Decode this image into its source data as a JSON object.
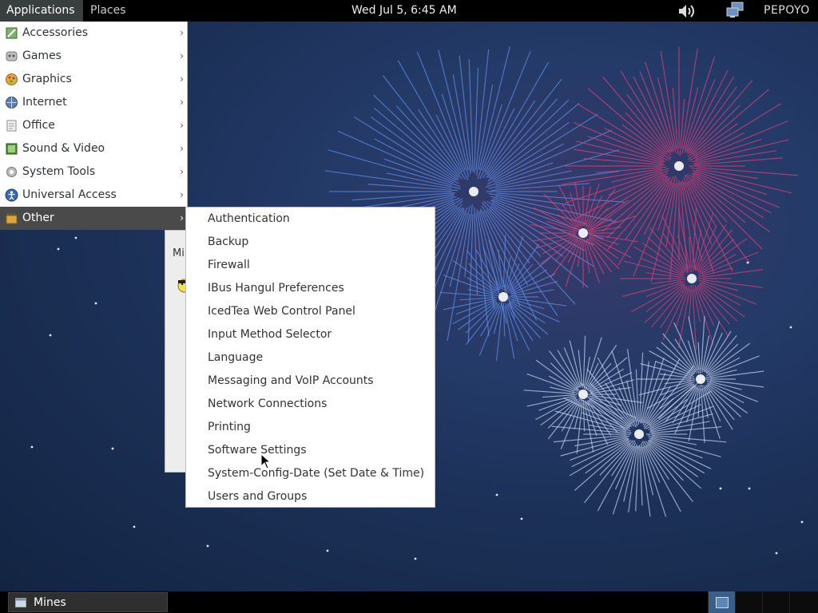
{
  "top_panel": {
    "applications": "Applications",
    "places": "Places",
    "clock": "Wed Jul  5,  6:45 AM",
    "user": "PEPOYO"
  },
  "app_menu": {
    "items": [
      {
        "label": "Accessories",
        "icon": "accessories-icon",
        "active": false
      },
      {
        "label": "Games",
        "icon": "games-icon",
        "active": false
      },
      {
        "label": "Graphics",
        "icon": "graphics-icon",
        "active": false
      },
      {
        "label": "Internet",
        "icon": "internet-icon",
        "active": false
      },
      {
        "label": "Office",
        "icon": "office-icon",
        "active": false
      },
      {
        "label": "Sound & Video",
        "icon": "sound-video-icon",
        "active": false
      },
      {
        "label": "System Tools",
        "icon": "system-tools-icon",
        "active": false
      },
      {
        "label": "Universal Access",
        "icon": "universal-access-icon",
        "active": false
      },
      {
        "label": "Other",
        "icon": "other-icon",
        "active": true
      }
    ]
  },
  "submenu": {
    "items": [
      "Authentication",
      "Backup",
      "Firewall",
      "IBus Hangul Preferences",
      "IcedTea Web Control Panel",
      "Input Method Selector",
      "Language",
      "Messaging and VoIP Accounts",
      "Network Connections",
      "Printing",
      "Software Settings",
      "System-Config-Date (Set Date & Time)",
      "Users and Groups"
    ]
  },
  "mines_window": {
    "title_fragment": "Mi"
  },
  "taskbar": {
    "task_label": "Mines"
  },
  "colors": {
    "panel": "#000000",
    "menu_active": "#4a4a4a",
    "workspace_active": "#3a5d8a"
  }
}
